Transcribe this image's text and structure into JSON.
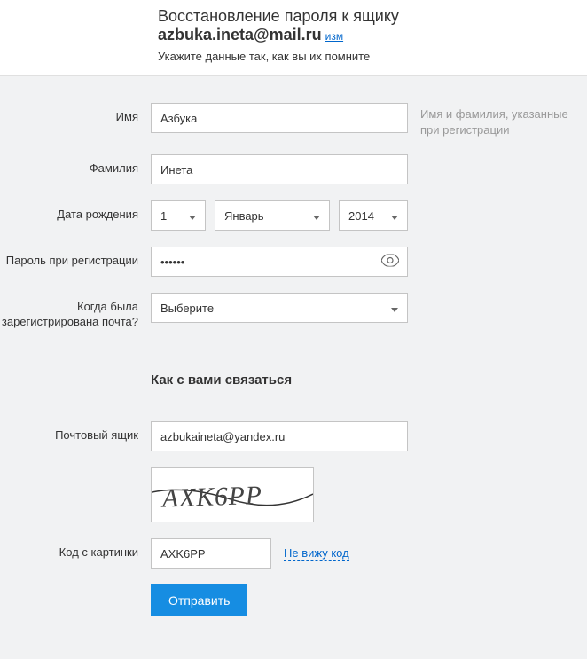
{
  "header": {
    "title_prefix": "Восстановление пароля к ящику ",
    "email": "azbuka.ineta@mail.ru",
    "change_link": "изм",
    "subtitle": "Укажите данные так, как вы их помните"
  },
  "labels": {
    "name": "Имя",
    "surname": "Фамилия",
    "birthdate": "Дата рождения",
    "password": "Пароль при регистрации",
    "when_registered": "Когда была зарегистрирована почта?",
    "mailbox": "Почтовый ящик",
    "captcha": "Код с картинки"
  },
  "hints": {
    "name": "Имя и фамилия, указанные при регистрации"
  },
  "values": {
    "name": "Азбука",
    "surname": "Инета",
    "day": "1",
    "month": "Январь",
    "year": "2014",
    "password_masked": "••••••",
    "when_registered": "Выберите",
    "mailbox": "azbukaineta@yandex.ru",
    "captcha_text": "AXK6PP",
    "captcha_input": "AXK6PP"
  },
  "section_contact": "Как с вами связаться",
  "links": {
    "cant_see": "Не вижу код"
  },
  "buttons": {
    "submit": "Отправить"
  }
}
